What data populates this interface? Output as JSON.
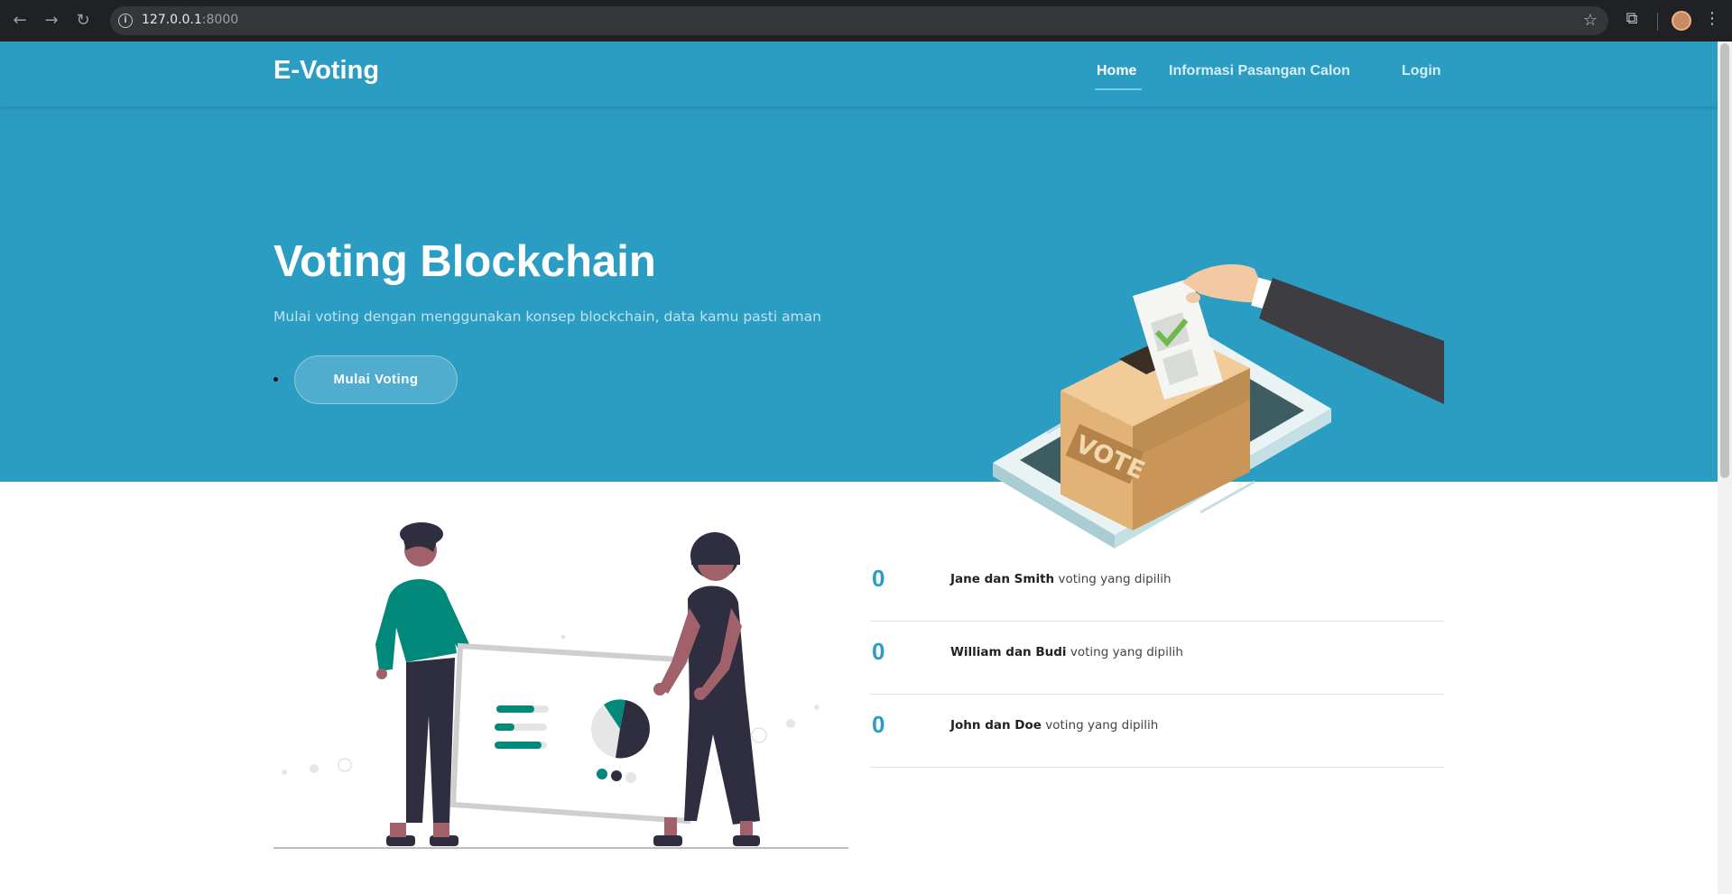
{
  "browser": {
    "url_host": "127.0.0.1",
    "url_port": ":8000"
  },
  "header": {
    "logo": "E-Voting",
    "nav": {
      "home": "Home",
      "info": "Informasi Pasangan Calon",
      "login": "Login"
    }
  },
  "hero": {
    "title": "Voting Blockchain",
    "subtitle": "Mulai voting dengan menggunakan konsep blockchain, data kamu pasti aman",
    "cta": "Mulai Voting",
    "ballot_label": "VOTE"
  },
  "votes": [
    {
      "count": "0",
      "name": "Jane dan Smith",
      "suffix": " voting yang dipilih"
    },
    {
      "count": "0",
      "name": "William dan Budi",
      "suffix": " voting yang dipilih"
    },
    {
      "count": "0",
      "name": "John dan Doe",
      "suffix": " voting yang dipilih"
    }
  ],
  "colors": {
    "primary": "#2b9cc2",
    "teal": "#00897b",
    "dark": "#2f2e41"
  }
}
